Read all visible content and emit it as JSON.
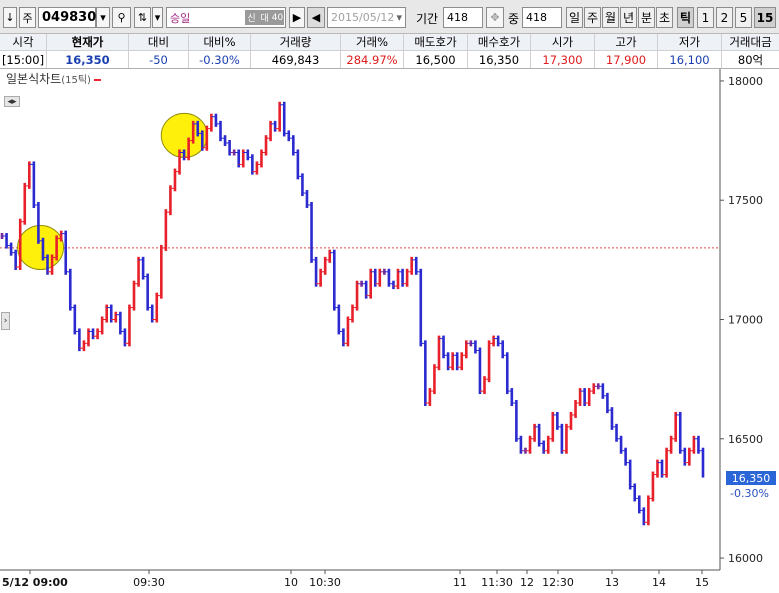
{
  "toolbar": {
    "dir_label": "↓",
    "market_label": "주",
    "code": "049830",
    "stock_name": "승일",
    "badges": [
      "신",
      "대",
      "40"
    ],
    "date": "2015/05/12",
    "period_label": "기간",
    "period_value": "418",
    "count_label": "중",
    "count_value": "418",
    "periods": [
      "일",
      "주",
      "월",
      "년",
      "분",
      "초",
      "틱",
      "1",
      "2",
      "5",
      "15"
    ],
    "selected_period": "틱"
  },
  "quote": {
    "headers": [
      "시각",
      "현재가",
      "대비",
      "대비%",
      "거래량",
      "거래%",
      "매도호가",
      "매수호가",
      "시가",
      "고가",
      "저가",
      "거래대금"
    ],
    "values": [
      "[15:00]",
      "16,350",
      "-50",
      "-0.30%",
      "469,843",
      "284.97%",
      "16,500",
      "16,350",
      "17,300",
      "17,900",
      "16,100",
      "80억"
    ]
  },
  "chart": {
    "title": "일본식차트",
    "subtitle": "(15틱)",
    "current_price": "16,350",
    "current_pct": "-0.30%",
    "colors": {
      "up": "#e8202a",
      "down": "#2a2ad0",
      "mixed": "#7a2a9a",
      "ref_line": "#e34b4b",
      "highlight": "#fff000"
    }
  },
  "chart_data": {
    "type": "line",
    "ylim": [
      15950,
      18050
    ],
    "y_ticks": [
      16000,
      16500,
      17000,
      17500,
      18000
    ],
    "x_labels": [
      "5/12 09:00",
      "09:30",
      "10",
      "10:30",
      "11",
      "11:30",
      "12",
      "12:30",
      "13",
      "14",
      "15"
    ],
    "reference_price": 17300,
    "values": [
      17350,
      17310,
      17280,
      17220,
      17410,
      17560,
      17650,
      17480,
      17330,
      17260,
      17200,
      17260,
      17340,
      17360,
      17200,
      17050,
      16950,
      16880,
      16900,
      16950,
      16930,
      16950,
      17000,
      17050,
      17000,
      17020,
      16950,
      16900,
      17050,
      17150,
      17250,
      17180,
      17050,
      17000,
      17100,
      17300,
      17450,
      17550,
      17620,
      17700,
      17680,
      17750,
      17820,
      17780,
      17720,
      17800,
      17850,
      17820,
      17760,
      17740,
      17700,
      17700,
      17650,
      17700,
      17680,
      17620,
      17650,
      17700,
      17760,
      17820,
      17800,
      17900,
      17780,
      17760,
      17700,
      17600,
      17530,
      17480,
      17250,
      17150,
      17200,
      17250,
      17280,
      17050,
      16950,
      16900,
      17000,
      17050,
      17150,
      17150,
      17100,
      17200,
      17150,
      17200,
      17200,
      17150,
      17140,
      17200,
      17150,
      17200,
      17250,
      17200,
      16900,
      16650,
      16700,
      16800,
      16920,
      16850,
      16800,
      16850,
      16800,
      16850,
      16900,
      16900,
      16870,
      16700,
      16750,
      16900,
      16920,
      16900,
      16850,
      16700,
      16650,
      16500,
      16450,
      16450,
      16500,
      16550,
      16480,
      16450,
      16500,
      16600,
      16550,
      16450,
      16550,
      16600,
      16650,
      16700,
      16650,
      16700,
      16720,
      16720,
      16680,
      16620,
      16550,
      16500,
      16450,
      16400,
      16300,
      16250,
      16200,
      16150,
      16250,
      16350,
      16400,
      16350,
      16450,
      16500,
      16600,
      16450,
      16400,
      16450,
      16500,
      16450,
      16350
    ]
  }
}
